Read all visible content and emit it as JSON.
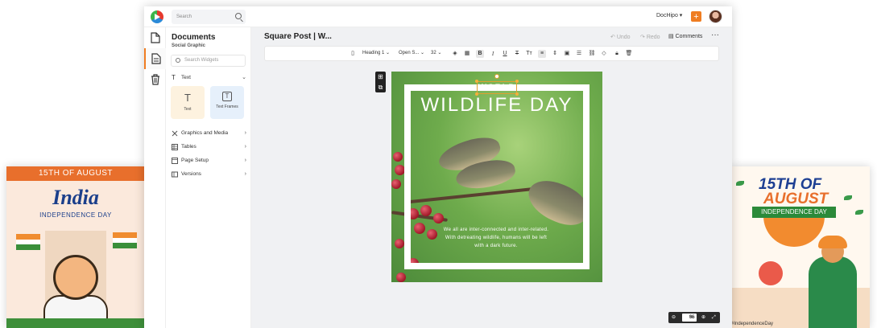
{
  "promo_left": {
    "banner": "15TH OF AUGUST",
    "title": "India",
    "subtitle": "INDEPENDENCE DAY"
  },
  "promo_right": {
    "line1": "15TH OF",
    "line2": "AUGUST",
    "ribbon": "INDEPENDENCE DAY",
    "hashtag": "#IndependenceDay"
  },
  "topbar": {
    "search_placeholder": "Search",
    "account": "DocHipo ▾",
    "plus": "+"
  },
  "panel": {
    "title": "Documents",
    "subtitle": "Social Graphic",
    "widget_search_placeholder": "Search Widgets",
    "text_section": "Text",
    "tiles": [
      {
        "label": "Text",
        "glyph": "T"
      },
      {
        "label": "Text Frames",
        "glyph": "T"
      }
    ],
    "sections": [
      "Graphics and Media",
      "Tables",
      "Page Setup",
      "Versions"
    ]
  },
  "editor": {
    "doc_title": "Square Post | W...",
    "undo": "Undo",
    "redo": "Redo",
    "comments": "Comments",
    "more": "···",
    "toolbar": {
      "heading": "Heading 1",
      "font": "Open S...",
      "size": "32",
      "bold": "B",
      "italic": "I",
      "underline": "U",
      "strike": "T",
      "case": "Tт"
    }
  },
  "design": {
    "tag": "WORLD",
    "headline": "WILDLIFE DAY",
    "caption_lines": [
      "We all are inter-connected and inter-related.",
      "With detreating wildlife, humans will be left",
      "with a dark future."
    ]
  },
  "zoom": {
    "value": "86",
    "unit": "%"
  },
  "colors": {
    "accent": "#ef7d22",
    "canvas_bg": "#f0f1f3",
    "design_green": "#6eab4c",
    "headline_text": "#ffffff"
  }
}
